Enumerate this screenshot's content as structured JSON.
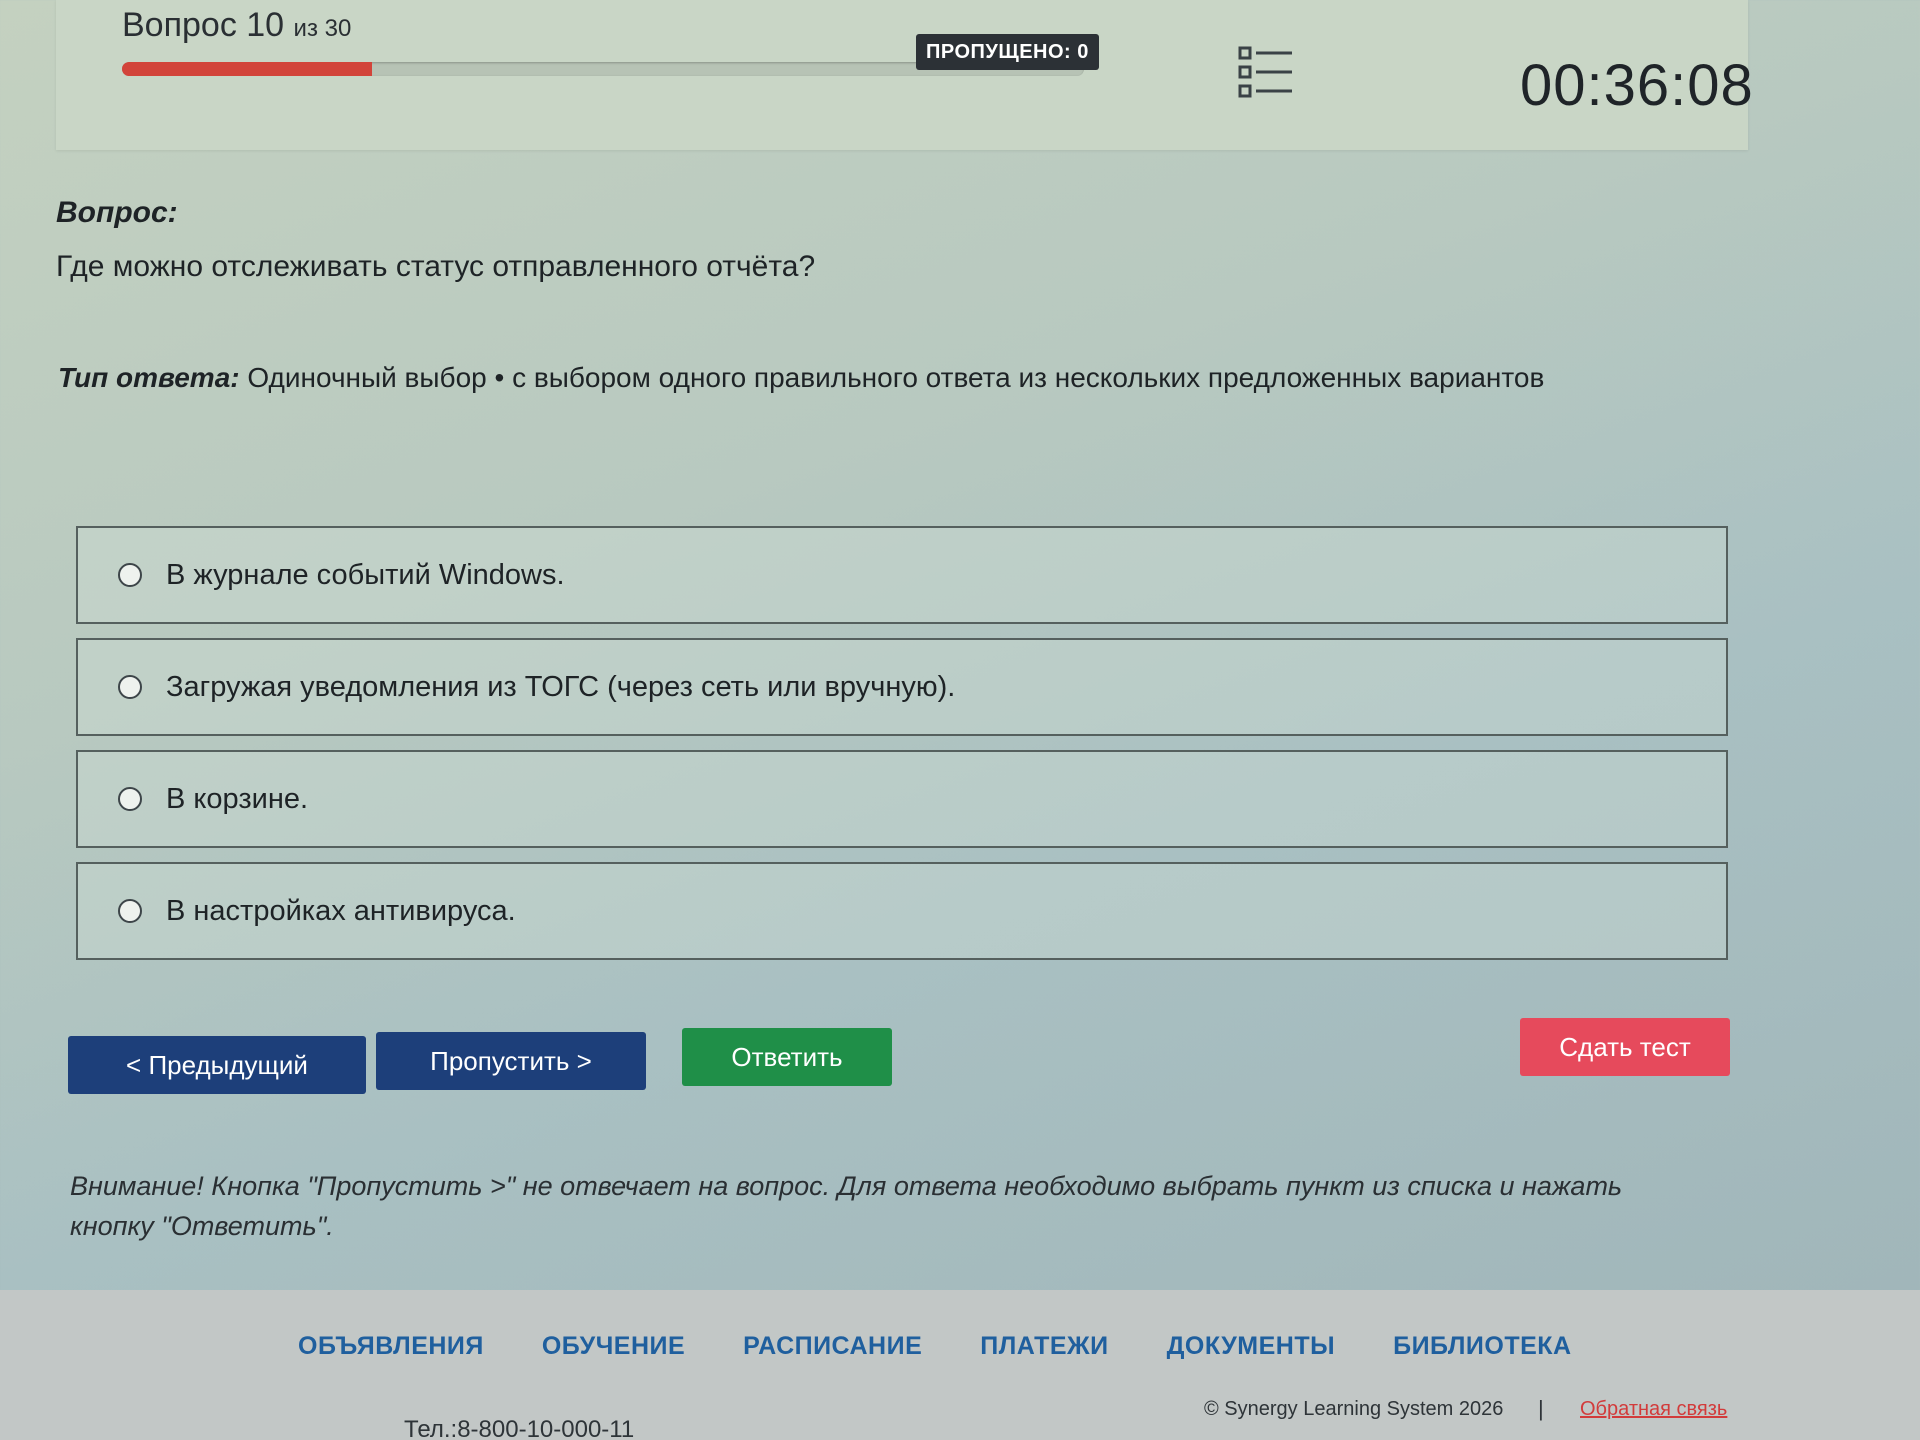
{
  "header": {
    "question_prefix": "Вопрос 10",
    "question_total": "из 30",
    "progress_fraction": 0.26,
    "skipped_badge": "ПРОПУЩЕНО: 0",
    "list_icon": "question-list-icon",
    "timer": "00:36:08"
  },
  "question": {
    "label": "Вопрос:",
    "text": "Где можно отслеживать статус отправленного отчёта?",
    "answer_type_label": "Тип ответа:",
    "answer_type_value": "Одиночный выбор • с выбором одного правильного ответа из нескольких предложенных вариантов"
  },
  "options": [
    {
      "label": "В журнале событий Windows."
    },
    {
      "label": "Загружая уведомления из ТОГС (через сеть или вручную)."
    },
    {
      "label": "В корзине."
    },
    {
      "label": "В настройках антивируса."
    }
  ],
  "buttons": {
    "prev": "< Предыдущий",
    "skip": "Пропустить >",
    "answer": "Ответить",
    "submit": "Сдать тест"
  },
  "notice": "Внимание! Кнопка \"Пропустить >\" не отвечает на вопрос. Для ответа необходимо выбрать пункт из списка и нажать кнопку \"Ответить\".",
  "footer": {
    "nav": [
      "ОБЪЯВЛЕНИЯ",
      "ОБУЧЕНИЕ",
      "РАСПИСАНИЕ",
      "ПЛАТЕЖИ",
      "ДОКУМЕНТЫ",
      "БИБЛИОТЕКА"
    ],
    "copyright": "© Synergy Learning System 2026",
    "separator": "|",
    "feedback": "Обратная связь",
    "phone": "Тел.:8-800-10-000-11"
  },
  "colors": {
    "primary_button": "#1d3f7a",
    "answer_button": "#1f8f48",
    "submit_button": "#e64a5c",
    "progress_fill": "#d2443a",
    "nav_link": "#1f5f9e"
  }
}
